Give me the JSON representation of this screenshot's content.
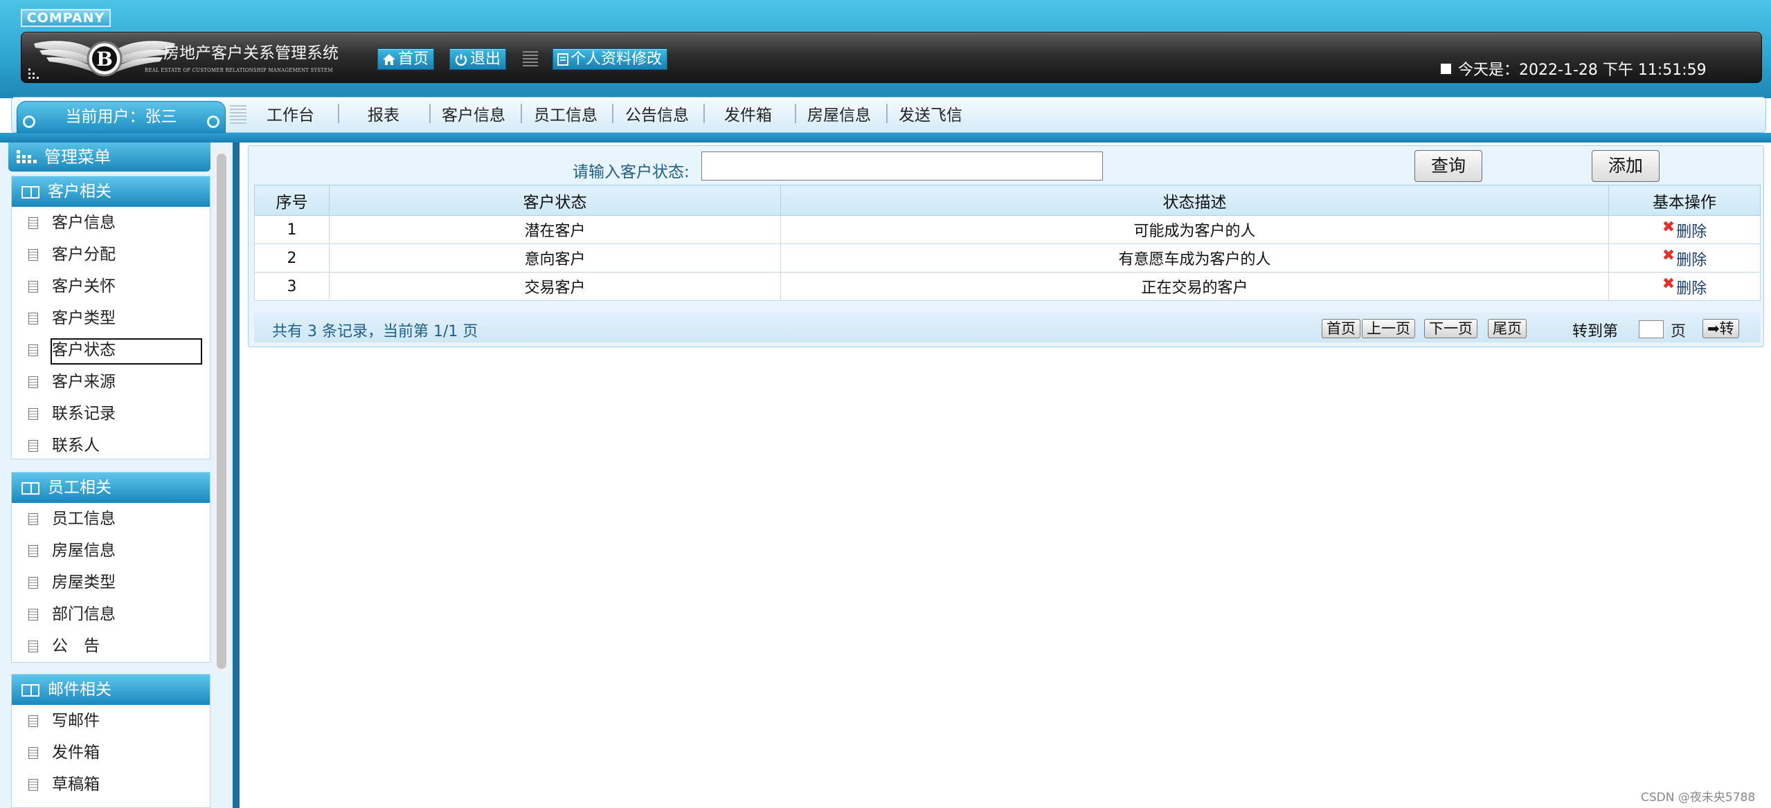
{
  "header": {
    "company": "COMPANY",
    "app_title": "房地产客户关系管理系统",
    "app_subtitle": "REAL ESTATE OF CUSTOMER RELATIONSHIP MANAGEMENT SYSTEM",
    "buttons": {
      "home": "首页",
      "logout": "退出",
      "profile": "个人资料修改"
    },
    "date_label": "今天是：",
    "date_value": "2022-1-28 下午 11:51:59"
  },
  "nav": {
    "current_user": "当前用户：张三",
    "items": [
      "工作台",
      "报表",
      "客户信息",
      "员工信息",
      "公告信息",
      "发件箱",
      "房屋信息",
      "发送飞信"
    ]
  },
  "sidebar": {
    "menu_title": "管理菜单",
    "groups": [
      {
        "title": "客户相关",
        "items": [
          "客户信息",
          "客户分配",
          "客户关怀",
          "客户类型",
          "客户状态",
          "客户来源",
          "联系记录",
          "联系人"
        ]
      },
      {
        "title": "员工相关",
        "items": [
          "员工信息",
          "房屋信息",
          "房屋类型",
          "部门信息",
          "公　告"
        ]
      },
      {
        "title": "邮件相关",
        "items": [
          "写邮件",
          "发件箱",
          "草稿箱"
        ]
      }
    ],
    "selected": "客户状态"
  },
  "main": {
    "search_label": "请输入客户状态:",
    "search_value": "",
    "query_button": "查询",
    "add_button": "添加",
    "table": {
      "headers": [
        "序号",
        "客户状态",
        "状态描述",
        "基本操作"
      ],
      "rows": [
        {
          "id": "1",
          "status": "潜在客户",
          "desc": "可能成为客户的人",
          "action": "删除"
        },
        {
          "id": "2",
          "status": "意向客户",
          "desc": "有意愿车成为客户的人",
          "action": "删除"
        },
        {
          "id": "3",
          "status": "交易客户",
          "desc": "正在交易的客户",
          "action": "删除"
        }
      ]
    },
    "pagination": {
      "summary": "共有 3 条记录，当前第 1/1 页",
      "first": "首页",
      "prev": "上一页",
      "next": "下一页",
      "last": "尾页",
      "goto_label": "转到第",
      "goto_value": "",
      "page_suffix": "页",
      "go": "➡转"
    }
  },
  "watermark": "CSDN @夜未央5788",
  "colors": {
    "accent": "#2fa8d4",
    "header_dark": "#2e2e2e",
    "delete_icon": "#e0322a"
  }
}
